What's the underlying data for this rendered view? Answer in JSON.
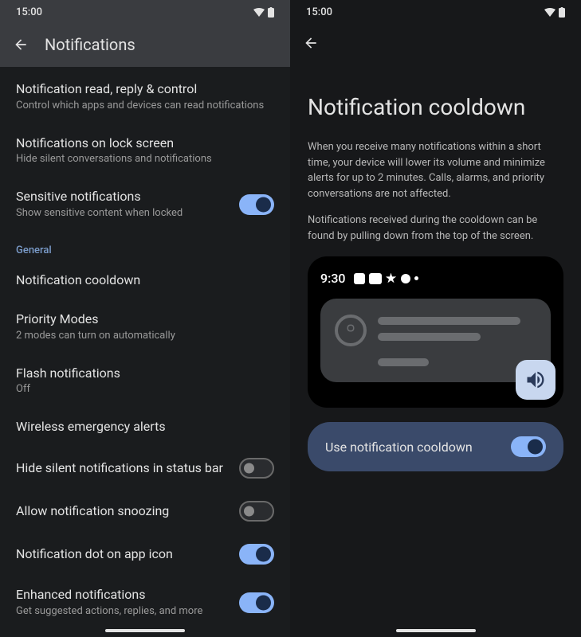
{
  "statusTime": "15:00",
  "left": {
    "headerTitle": "Notifications",
    "items": [
      {
        "title": "Notification read, reply & control",
        "subtitle": "Control which apps and devices can read notifications"
      },
      {
        "title": "Notifications on lock screen",
        "subtitle": "Hide silent conversations and notifications"
      },
      {
        "title": "Sensitive notifications",
        "subtitle": "Show sensitive content when locked",
        "toggle": "on"
      }
    ],
    "sectionHeader": "General",
    "generalItems": [
      {
        "title": "Notification cooldown"
      },
      {
        "title": "Priority Modes",
        "subtitle": "2 modes can turn on automatically"
      },
      {
        "title": "Flash notifications",
        "subtitle": "Off"
      },
      {
        "title": "Wireless emergency alerts"
      },
      {
        "title": "Hide silent notifications in status bar",
        "toggle": "off"
      },
      {
        "title": "Allow notification snoozing",
        "toggle": "off"
      },
      {
        "title": "Notification dot on app icon",
        "toggle": "on"
      },
      {
        "title": "Enhanced notifications",
        "subtitle": "Get suggested actions, replies, and more",
        "toggle": "on"
      }
    ]
  },
  "right": {
    "title": "Notification cooldown",
    "desc1": "When you receive many notifications within a short time, your device will lower its volume and minimize alerts for up to 2 minutes. Calls, alarms, and priority conversations are not affected.",
    "desc2": "Notifications received during the cooldown can be found by pulling down from the top of the screen.",
    "illustrationTime": "9:30",
    "toggleLabel": "Use notification cooldown"
  }
}
